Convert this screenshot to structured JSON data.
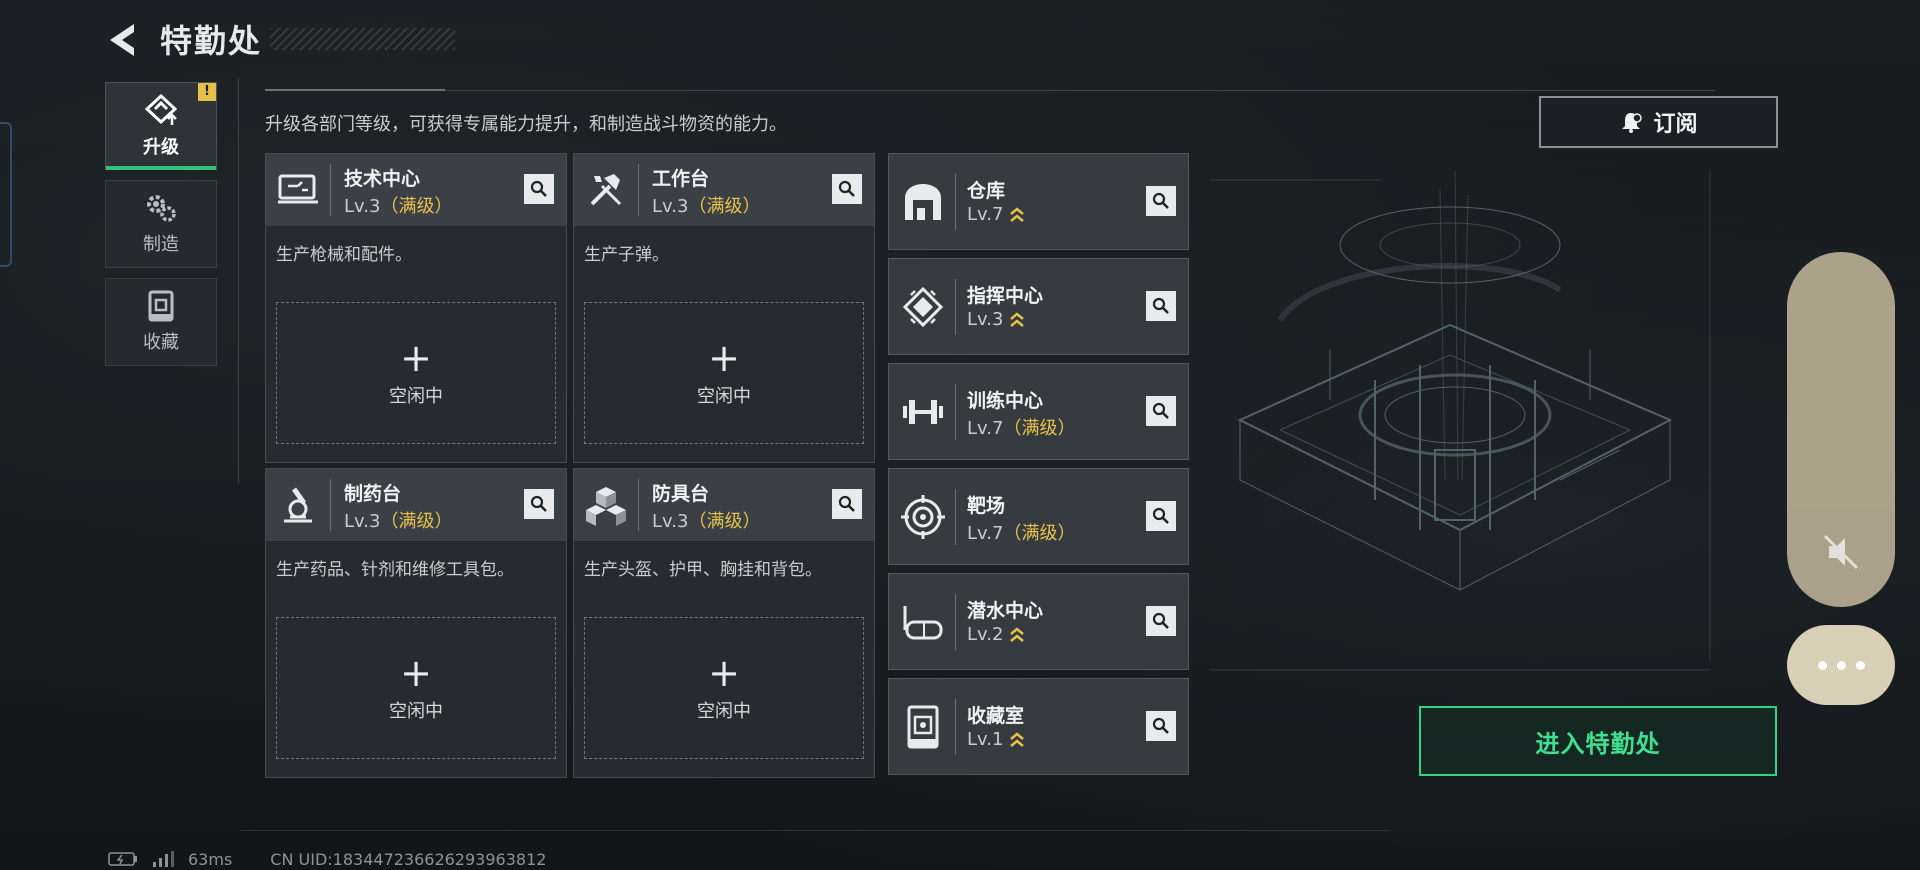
{
  "header": {
    "title": "特勤处"
  },
  "side_tabs": [
    {
      "label": "升级",
      "icon": "upgrade-icon",
      "active": true,
      "badge": "!"
    },
    {
      "label": "制造",
      "icon": "gears-icon",
      "active": false
    },
    {
      "label": "收藏",
      "icon": "collection-icon",
      "active": false
    }
  ],
  "description": "升级各部门等级，可获得专属能力提升，和制造战斗物资的能力。",
  "subscribe_label": "订阅",
  "craft_stations": [
    {
      "name": "技术中心",
      "level": "Lv.3",
      "max_tag": "（满级）",
      "desc": "生产枪械和配件。",
      "slot_label": "空闲中",
      "slot_plus": "+",
      "icon": "computer-icon"
    },
    {
      "name": "工作台",
      "level": "Lv.3",
      "max_tag": "（满级）",
      "desc": "生产子弹。",
      "slot_label": "空闲中",
      "slot_plus": "+",
      "icon": "tools-icon"
    },
    {
      "name": "制药台",
      "level": "Lv.3",
      "max_tag": "（满级）",
      "desc": "生产药品、针剂和维修工具包。",
      "slot_label": "空闲中",
      "slot_plus": "+",
      "icon": "microscope-icon"
    },
    {
      "name": "防具台",
      "level": "Lv.3",
      "max_tag": "（满级）",
      "desc": "生产头盔、护甲、胸挂和背包。",
      "slot_label": "空闲中",
      "slot_plus": "+",
      "icon": "armor-boxes-icon"
    }
  ],
  "facilities": [
    {
      "name": "仓库",
      "level": "Lv.7",
      "max_tag": "",
      "upgradable": true,
      "icon": "warehouse-icon"
    },
    {
      "name": "指挥中心",
      "level": "Lv.3",
      "max_tag": "",
      "upgradable": true,
      "icon": "command-chip-icon"
    },
    {
      "name": "训练中心",
      "level": "Lv.7",
      "max_tag": "（满级）",
      "upgradable": false,
      "icon": "dumbbell-icon"
    },
    {
      "name": "靶场",
      "level": "Lv.7",
      "max_tag": "（满级）",
      "upgradable": false,
      "icon": "target-icon"
    },
    {
      "name": "潜水中心",
      "level": "Lv.2",
      "max_tag": "",
      "upgradable": true,
      "icon": "diving-mask-icon"
    },
    {
      "name": "收藏室",
      "level": "Lv.1",
      "max_tag": "",
      "upgradable": true,
      "icon": "vault-icon"
    }
  ],
  "enter_label": "进入特勤处",
  "status": {
    "ping": "63ms",
    "uid": "CN UID:183447236626293963812"
  },
  "colors": {
    "accent_green": "#35c27a",
    "max_level_gold": "#e7c24a",
    "badge_yellow": "#e6c148"
  }
}
